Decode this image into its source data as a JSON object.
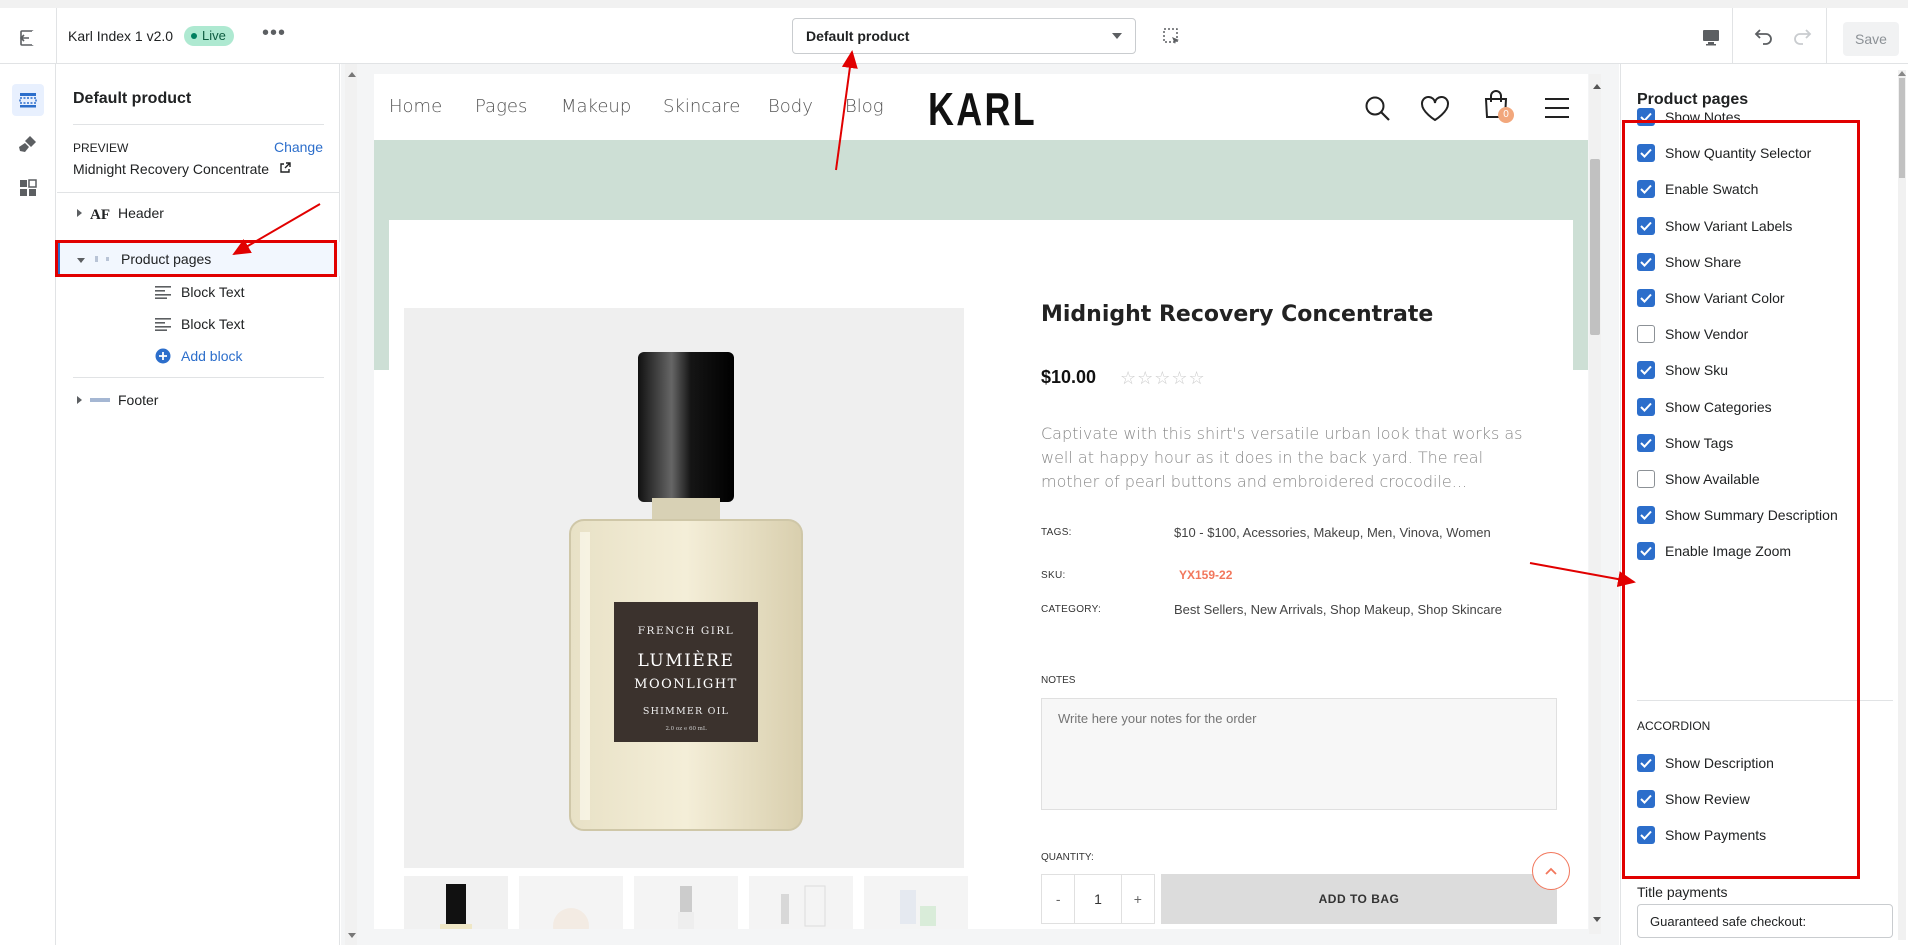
{
  "topbar": {
    "exit_icon": "exit-icon",
    "theme_name": "Karl Index 1 v2.0",
    "status": "Live",
    "more": "•••",
    "template_select": "Default product",
    "save": "Save"
  },
  "left_panel": {
    "title": "Default product",
    "preview_label": "PREVIEW",
    "change": "Change",
    "preview_product": "Midnight Recovery Concentrate",
    "sections": {
      "header": "Header",
      "product_pages": "Product pages",
      "blocks": [
        "Block Text",
        "Block Text"
      ],
      "add_block": "Add block",
      "footer": "Footer"
    }
  },
  "site": {
    "nav": [
      "Home",
      "Pages",
      "Makeup",
      "Skincare",
      "Body",
      "Blog"
    ],
    "logo": "KARL",
    "cart_count": "0",
    "product": {
      "title": "Midnight Recovery Concentrate",
      "price": "$10.00",
      "stars": "☆☆☆☆☆",
      "description": "Captivate with this shirt's versatile urban look that works as well at happy hour as it does in the back yard. The real mother of pearl buttons and embroidered crocodile...",
      "tags_label": "TAGS:",
      "tags": "$10 - $100, Acessories, Makeup, Men, Vinova, Women",
      "sku_label": "SKU:",
      "sku": "YX159-22",
      "category_label": "CATEGORY:",
      "category": "Best Sellers, New Arrivals, Shop Makeup, Shop Skincare",
      "notes_label": "NOTES",
      "notes_placeholder": "Write here your notes for the order",
      "quantity_label": "QUANTITY:",
      "qty_minus": "-",
      "qty_value": "1",
      "qty_plus": "+",
      "add_to_bag": "ADD TO BAG",
      "bottle_label": {
        "line1": "FRENCH GIRL",
        "line2": "LUMIÈRE",
        "line3": "MOONLIGHT",
        "line4": "SHIMMER OIL",
        "line5": "2.0 oz ℮ 60 mL"
      }
    }
  },
  "right_panel": {
    "title": "Product pages",
    "options": [
      {
        "label": "Show Notes",
        "checked": true
      },
      {
        "label": "Show Quantity Selector",
        "checked": true
      },
      {
        "label": "Enable Swatch",
        "checked": true
      },
      {
        "label": "Show Variant Labels",
        "checked": true
      },
      {
        "label": "Show Share",
        "checked": true
      },
      {
        "label": "Show Variant Color",
        "checked": true
      },
      {
        "label": "Show Vendor",
        "checked": false
      },
      {
        "label": "Show Sku",
        "checked": true
      },
      {
        "label": "Show Categories",
        "checked": true
      },
      {
        "label": "Show Tags",
        "checked": true
      },
      {
        "label": "Show Available",
        "checked": false
      },
      {
        "label": "Show Summary Description",
        "checked": true
      },
      {
        "label": "Enable Image Zoom",
        "checked": true
      }
    ],
    "accordion_heading": "ACCORDION",
    "accordion": [
      {
        "label": "Show Description",
        "checked": true
      },
      {
        "label": "Show Review",
        "checked": true
      },
      {
        "label": "Show Payments",
        "checked": true
      }
    ],
    "title_payments_label": "Title payments",
    "title_payments_value": "Guaranteed safe checkout:"
  },
  "colors": {
    "accent": "#2c6ecb",
    "annotation": "#e10000",
    "live_badge": "#aee9d1",
    "hero_bg": "#cddfd5",
    "sku": "#f2775c"
  }
}
